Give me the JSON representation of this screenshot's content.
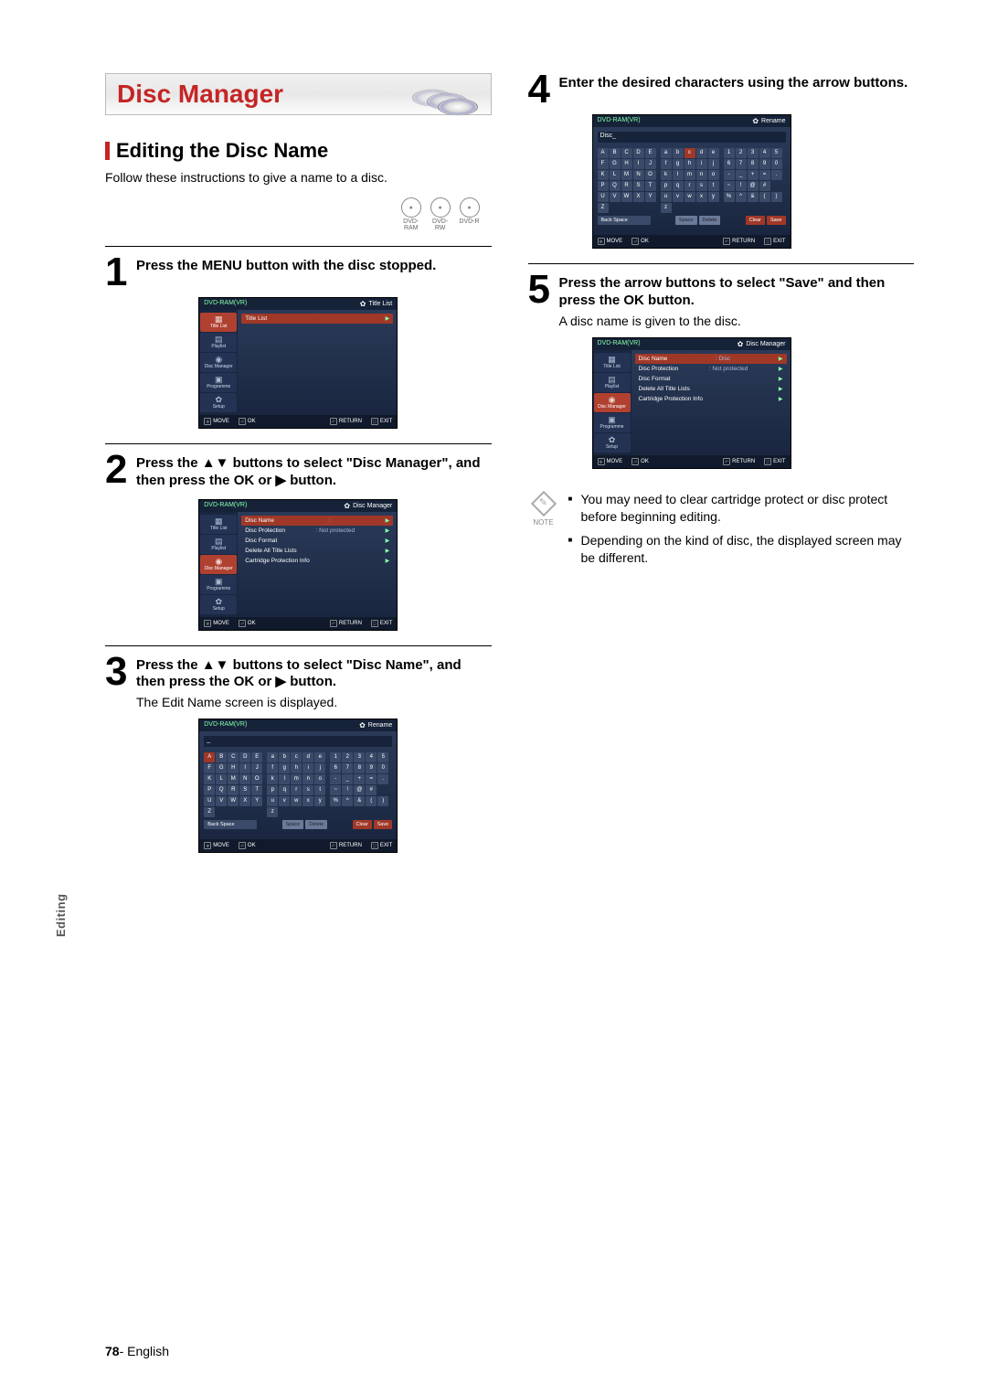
{
  "header": {
    "title": "Disc Manager"
  },
  "section": {
    "heading": "Editing the Disc Name",
    "subtext": "Follow these instructions to give a name to a disc."
  },
  "disc_types": [
    "DVD-RAM",
    "DVD-RW",
    "DVD-R"
  ],
  "steps": {
    "s1": {
      "num": "1",
      "text": "Press the MENU button with the disc stopped."
    },
    "s2": {
      "num": "2",
      "text": "Press the ▲▼ buttons to select \"Disc Manager\", and then press the OK or ▶ button."
    },
    "s3": {
      "num": "3",
      "text": "Press the ▲▼ buttons to select \"Disc Name\", and then press the OK or ▶ button.",
      "note": "The Edit Name screen is displayed."
    },
    "s4": {
      "num": "4",
      "text": "Enter the desired characters using the arrow buttons."
    },
    "s5": {
      "num": "5",
      "text": "Press the arrow buttons to select \"Save\" and then press the OK button.",
      "note": "A disc name is given to the disc."
    }
  },
  "screens": {
    "s1": {
      "breadcrumb": "DVD-RAM(VR)",
      "title_right": "Title List",
      "sidebar": [
        "Title List",
        "Playlist",
        "Disc Manager",
        "Programme",
        "Setup"
      ],
      "sidebar_sel": 0,
      "rows": [
        {
          "label": "Title List",
          "val": "",
          "sel": true
        }
      ]
    },
    "s2": {
      "breadcrumb": "DVD-RAM(VR)",
      "title_right": "Disc Manager",
      "sidebar": [
        "Title List",
        "Playlist",
        "Disc Manager",
        "Programme",
        "Setup"
      ],
      "sidebar_sel": 2,
      "rows": [
        {
          "label": "Disc Name",
          "val": ":",
          "sel": true
        },
        {
          "label": "Disc Protection",
          "val": ": Not protected",
          "sel": false
        },
        {
          "label": "Disc Format",
          "val": "",
          "sel": false
        },
        {
          "label": "Delete All Title Lists",
          "val": "",
          "sel": false
        },
        {
          "label": "Cartridge Protection Info",
          "val": "",
          "sel": false
        }
      ]
    },
    "s3": {
      "breadcrumb": "DVD-RAM(VR)",
      "title_right": "Rename",
      "input_value": "_",
      "sel_key": "A"
    },
    "s4": {
      "breadcrumb": "DVD-RAM(VR)",
      "title_right": "Rename",
      "input_label": "Disc",
      "input_value": "_",
      "sel_key": "c"
    },
    "s5": {
      "breadcrumb": "DVD-RAM(VR)",
      "title_right": "Disc Manager",
      "sidebar": [
        "Title List",
        "Playlist",
        "Disc Manager",
        "Programme",
        "Setup"
      ],
      "sidebar_sel": 2,
      "rows": [
        {
          "label": "Disc Name",
          "val": ": Disc",
          "sel": true
        },
        {
          "label": "Disc Protection",
          "val": ": Not protected",
          "sel": false
        },
        {
          "label": "Disc Format",
          "val": "",
          "sel": false
        },
        {
          "label": "Delete All Title Lists",
          "val": "",
          "sel": false
        },
        {
          "label": "Cartridge Protection Info",
          "val": "",
          "sel": false
        }
      ]
    },
    "footer": {
      "move": "MOVE",
      "ok": "OK",
      "return": "RETURN",
      "exit": "EXIT"
    }
  },
  "keyboard": {
    "upper": [
      "A",
      "B",
      "C",
      "D",
      "E",
      "F",
      "G",
      "H",
      "I",
      "J",
      "K",
      "L",
      "M",
      "N",
      "O",
      "P",
      "Q",
      "R",
      "S",
      "T",
      "U",
      "V",
      "W",
      "X",
      "Y",
      "Z",
      "",
      "",
      "",
      ""
    ],
    "lower": [
      "a",
      "b",
      "c",
      "d",
      "e",
      "f",
      "g",
      "h",
      "i",
      "j",
      "k",
      "l",
      "m",
      "n",
      "o",
      "p",
      "q",
      "r",
      "s",
      "t",
      "u",
      "v",
      "w",
      "x",
      "y",
      "z",
      "",
      "",
      "",
      ""
    ],
    "nums": [
      "1",
      "2",
      "3",
      "4",
      "5",
      "6",
      "7",
      "8",
      "9",
      "0",
      "-",
      "_",
      "+",
      "=",
      ".",
      "~",
      "!",
      "@",
      "#",
      "",
      "%",
      "^",
      "&",
      "(",
      ")",
      "",
      "",
      "",
      "",
      ""
    ],
    "buttons": {
      "backspace": "Back Space",
      "space": "Space",
      "delete": "Delete",
      "clear": "Clear",
      "save": "Save"
    }
  },
  "notes": {
    "label": "NOTE",
    "items": [
      "You may need to clear cartridge protect or disc protect before beginning editing.",
      "Depending on the kind of disc, the displayed screen may be different."
    ]
  },
  "side_tab": {
    "text": "Editing"
  },
  "page_footer": {
    "num": "78",
    "sep": "- ",
    "lang": "English"
  }
}
